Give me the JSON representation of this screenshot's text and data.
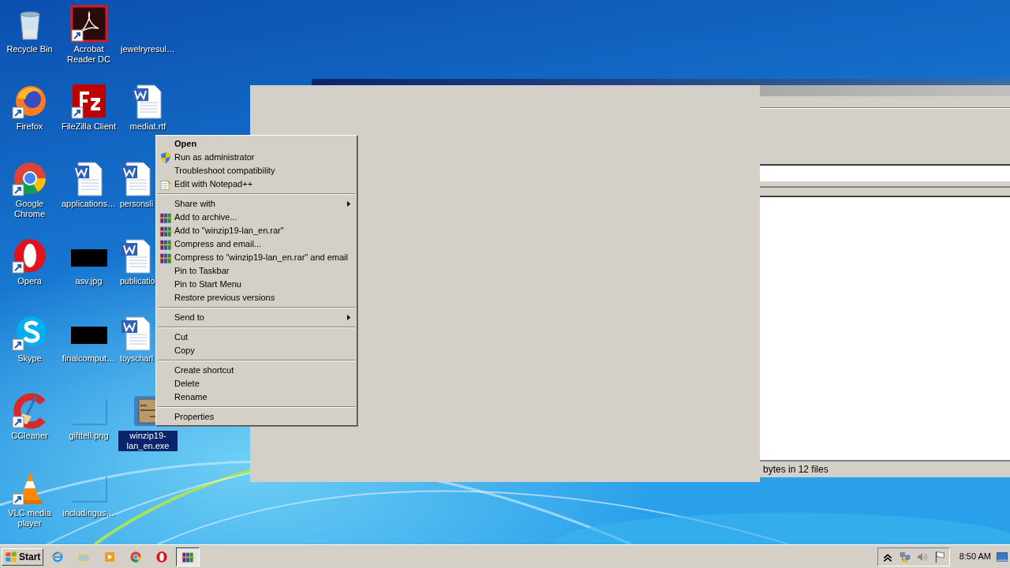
{
  "desktop": {
    "icons": [
      {
        "label": "Recycle Bin",
        "kind": "recycle",
        "shortcut": false,
        "selected": false
      },
      {
        "label": "Firefox",
        "kind": "firefox",
        "shortcut": true,
        "selected": false
      },
      {
        "label": "Google Chrome",
        "kind": "chrome",
        "shortcut": true,
        "selected": false
      },
      {
        "label": "Opera",
        "kind": "opera",
        "shortcut": true,
        "selected": false
      },
      {
        "label": "Skype",
        "kind": "skype",
        "shortcut": true,
        "selected": false
      },
      {
        "label": "CCleaner",
        "kind": "ccleaner",
        "shortcut": true,
        "selected": false
      },
      {
        "label": "VLC media player",
        "kind": "vlc",
        "shortcut": true,
        "selected": false
      },
      {
        "label": "Acrobat Reader DC",
        "kind": "acrobat",
        "shortcut": true,
        "selected": false
      },
      {
        "label": "FileZilla Client",
        "kind": "filezilla",
        "shortcut": true,
        "selected": false
      },
      {
        "label": "applications…",
        "kind": "word",
        "shortcut": false,
        "selected": false
      },
      {
        "label": "asv.jpg",
        "kind": "black",
        "shortcut": false,
        "selected": false
      },
      {
        "label": "finalcomput…",
        "kind": "black",
        "shortcut": false,
        "selected": false
      },
      {
        "label": "gifttell.png",
        "kind": "blank",
        "shortcut": false,
        "selected": false
      },
      {
        "label": "includingus…",
        "kind": "blank",
        "shortcut": false,
        "selected": false
      },
      {
        "label": "jewelryresul…",
        "kind": "blank",
        "shortcut": false,
        "selected": false
      },
      {
        "label": "mediat.rtf",
        "kind": "word",
        "shortcut": false,
        "selected": false
      },
      {
        "label": "personsli",
        "kind": "word",
        "shortcut": false,
        "selected": false
      },
      {
        "label": "publicatio",
        "kind": "word",
        "shortcut": false,
        "selected": false
      },
      {
        "label": "toyscharl",
        "kind": "word",
        "shortcut": false,
        "selected": false
      },
      {
        "label": "winzip19-lan_en.exe",
        "kind": "archive",
        "shortcut": false,
        "selected": true
      }
    ]
  },
  "back_window": {
    "status_text": "bytes in 12 files"
  },
  "context_menu": {
    "items": [
      {
        "kind": "plain",
        "label": "Open",
        "default": true,
        "submenu": false
      },
      {
        "kind": "shield",
        "label": "Run as administrator",
        "default": false,
        "submenu": false
      },
      {
        "kind": "plain",
        "label": "Troubleshoot compatibility",
        "default": false,
        "submenu": false
      },
      {
        "kind": "notepad",
        "label": "Edit with Notepad++",
        "default": false,
        "submenu": false
      },
      {
        "kind": "separator"
      },
      {
        "kind": "plain",
        "label": "Share with",
        "default": false,
        "submenu": true
      },
      {
        "kind": "archive",
        "label": "Add to archive...",
        "default": false,
        "submenu": false
      },
      {
        "kind": "archive",
        "label": "Add to \"winzip19-lan_en.rar\"",
        "default": false,
        "submenu": false
      },
      {
        "kind": "archive",
        "label": "Compress and email...",
        "default": false,
        "submenu": false
      },
      {
        "kind": "archive",
        "label": "Compress to \"winzip19-lan_en.rar\" and email",
        "default": false,
        "submenu": false
      },
      {
        "kind": "plain",
        "label": "Pin to Taskbar",
        "default": false,
        "submenu": false
      },
      {
        "kind": "plain",
        "label": "Pin to Start Menu",
        "default": false,
        "submenu": false
      },
      {
        "kind": "plain",
        "label": "Restore previous versions",
        "default": false,
        "submenu": false
      },
      {
        "kind": "separator"
      },
      {
        "kind": "plain",
        "label": "Send to",
        "default": false,
        "submenu": true
      },
      {
        "kind": "separator"
      },
      {
        "kind": "plain",
        "label": "Cut",
        "default": false,
        "submenu": false
      },
      {
        "kind": "plain",
        "label": "Copy",
        "default": false,
        "submenu": false
      },
      {
        "kind": "separator"
      },
      {
        "kind": "plain",
        "label": "Create shortcut",
        "default": false,
        "submenu": false
      },
      {
        "kind": "plain",
        "label": "Delete",
        "default": false,
        "submenu": false
      },
      {
        "kind": "plain",
        "label": "Rename",
        "default": false,
        "submenu": false
      },
      {
        "kind": "separator"
      },
      {
        "kind": "plain",
        "label": "Properties",
        "default": false,
        "submenu": false
      }
    ]
  },
  "taskbar": {
    "start_label": "Start",
    "items": [
      {
        "kind": "ie",
        "selected": false
      },
      {
        "kind": "explorer",
        "selected": false
      },
      {
        "kind": "media",
        "selected": false
      },
      {
        "kind": "chrome",
        "selected": false
      },
      {
        "kind": "opera",
        "selected": false
      },
      {
        "kind": "winrar",
        "selected": true
      }
    ],
    "tray": [
      {
        "kind": "chevron"
      },
      {
        "kind": "network"
      },
      {
        "kind": "volume"
      },
      {
        "kind": "flag"
      }
    ],
    "clock": "8:50 AM"
  }
}
